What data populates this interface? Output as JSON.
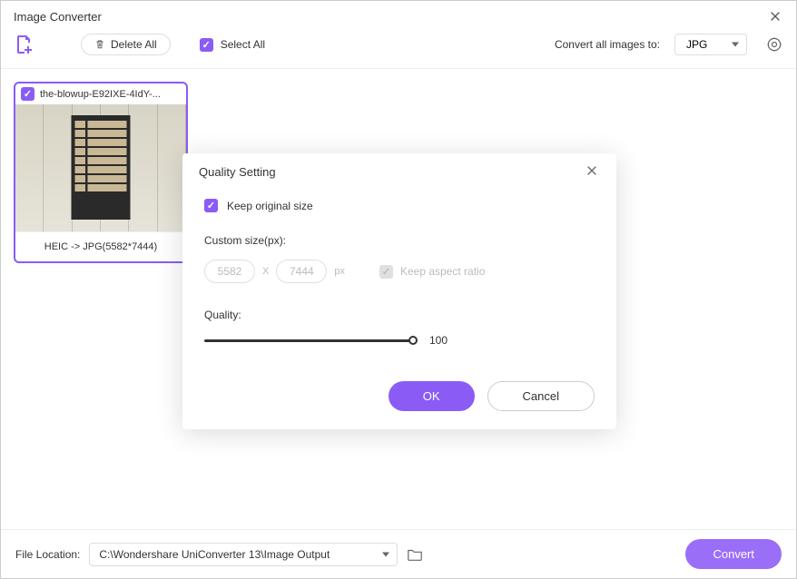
{
  "window": {
    "title": "Image Converter"
  },
  "toolbar": {
    "delete_all": "Delete All",
    "select_all": "Select All",
    "convert_label": "Convert all images to:",
    "format": "JPG"
  },
  "thumbnail": {
    "filename": "the-blowup-E92IXE-4IdY-...",
    "conversion": "HEIC -> JPG(5582*7444)"
  },
  "modal": {
    "title": "Quality Setting",
    "keep_original": "Keep original size",
    "custom_size_label": "Custom size(px):",
    "width": "5582",
    "height": "7444",
    "px": "px",
    "x_sep": "X",
    "keep_aspect": "Keep aspect ratio",
    "quality_label": "Quality:",
    "quality_value": "100",
    "ok": "OK",
    "cancel": "Cancel"
  },
  "footer": {
    "label": "File Location:",
    "path": "C:\\Wondershare UniConverter 13\\Image Output",
    "convert": "Convert"
  }
}
